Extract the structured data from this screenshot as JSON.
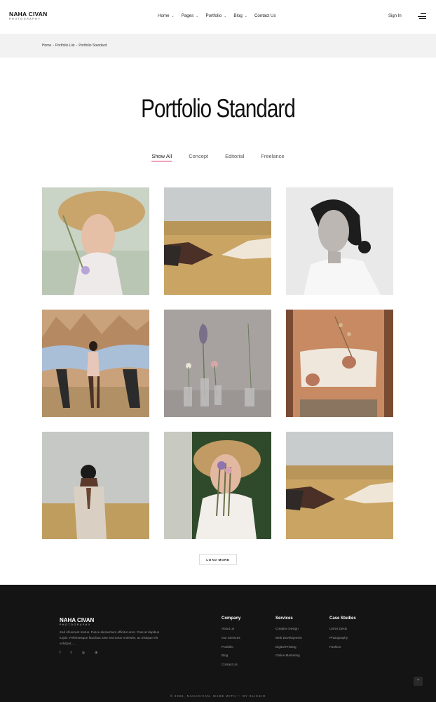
{
  "header": {
    "logo_name": "NAHA CIVAN",
    "logo_sub": "PHOTOGRAPHY",
    "nav": [
      {
        "label": "Home",
        "has_menu": true
      },
      {
        "label": "Pages",
        "has_menu": true
      },
      {
        "label": "Portfolio",
        "has_menu": true
      },
      {
        "label": "Blog",
        "has_menu": true
      },
      {
        "label": "Contact Us",
        "has_menu": false
      }
    ],
    "sign_in": "Sign In",
    "menu_icon": "hamburger-icon"
  },
  "breadcrumb": [
    "Home",
    "-",
    "Portfolio List",
    "-",
    "Portfolio Standard"
  ],
  "title": "Portfolio Standard",
  "filters": [
    {
      "label": "Show All",
      "active": true
    },
    {
      "label": "Concept",
      "active": false
    },
    {
      "label": "Editorial",
      "active": false
    },
    {
      "label": "Freelance",
      "active": false
    }
  ],
  "accent_color": "#d6336c",
  "portfolio_items": [
    {
      "image": "woman-straw-hat-flowers"
    },
    {
      "image": "hands-wheat-field"
    },
    {
      "image": "woman-portrait-bw"
    },
    {
      "image": "desert-fabric-models"
    },
    {
      "image": "flowers-glass-vases"
    },
    {
      "image": "woman-holding-dried-flowers"
    },
    {
      "image": "man-hands-over-eyes-field"
    },
    {
      "image": "woman-hat-bouquet"
    },
    {
      "image": "hands-wheat-field"
    }
  ],
  "load_more": "LOAD MORE",
  "footer": {
    "logo_name": "NAHA CIVAN",
    "logo_sub": "PHOTOGRAPHY",
    "description": "Sed id laoreet metus. Fusce elementum efficitur eros. Cras at dapibus turpis. Pellentesque faucibus ante sed tortor molestie, ac tristique elit volutpat......",
    "social": [
      "facebook-icon",
      "twitter-icon",
      "instagram-icon",
      "dribbble-icon"
    ],
    "columns": [
      {
        "title": "Company",
        "links": [
          "About us",
          "Our Services",
          "Portfolio",
          "Blog",
          "Contact Us"
        ]
      },
      {
        "title": "Services",
        "links": [
          "Creative Design",
          "Web Development",
          "Digital Printing",
          "Online Marketing"
        ]
      },
      {
        "title": "Case Studies",
        "links": [
          "UX/UI Desin",
          "Photography",
          "Fashion"
        ]
      }
    ],
    "copyright": "© 2025, NAHACIVAN. MADE WITH ♡ BY ELISSIO"
  }
}
